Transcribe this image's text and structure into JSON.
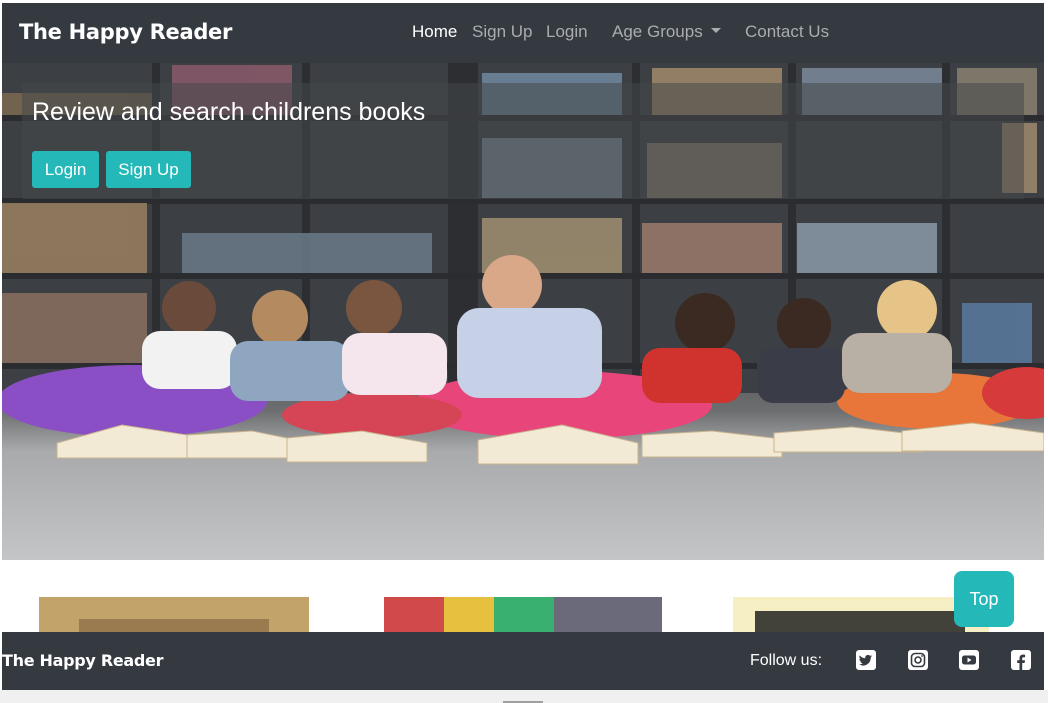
{
  "navbar": {
    "brand": "The Happy Reader",
    "links": [
      {
        "label": "Home",
        "active": true
      },
      {
        "label": "Sign Up",
        "active": false
      },
      {
        "label": "Login",
        "active": false
      },
      {
        "label": "Age Groups",
        "active": false
      },
      {
        "label": "Contact Us",
        "active": false
      }
    ]
  },
  "hero": {
    "title": "Review and search childrens books",
    "login_label": "Login",
    "signup_label": "Sign Up"
  },
  "top_button": {
    "label": "Top"
  },
  "footer": {
    "brand": "The Happy Reader",
    "follow_label": "Follow us:",
    "social_icons": [
      "twitter-icon",
      "instagram-icon",
      "youtube-icon",
      "facebook-icon"
    ]
  },
  "colors": {
    "navbar_bg": "#343a40",
    "accent": "#25b8b8",
    "nav_inactive": "#a9adb1"
  }
}
